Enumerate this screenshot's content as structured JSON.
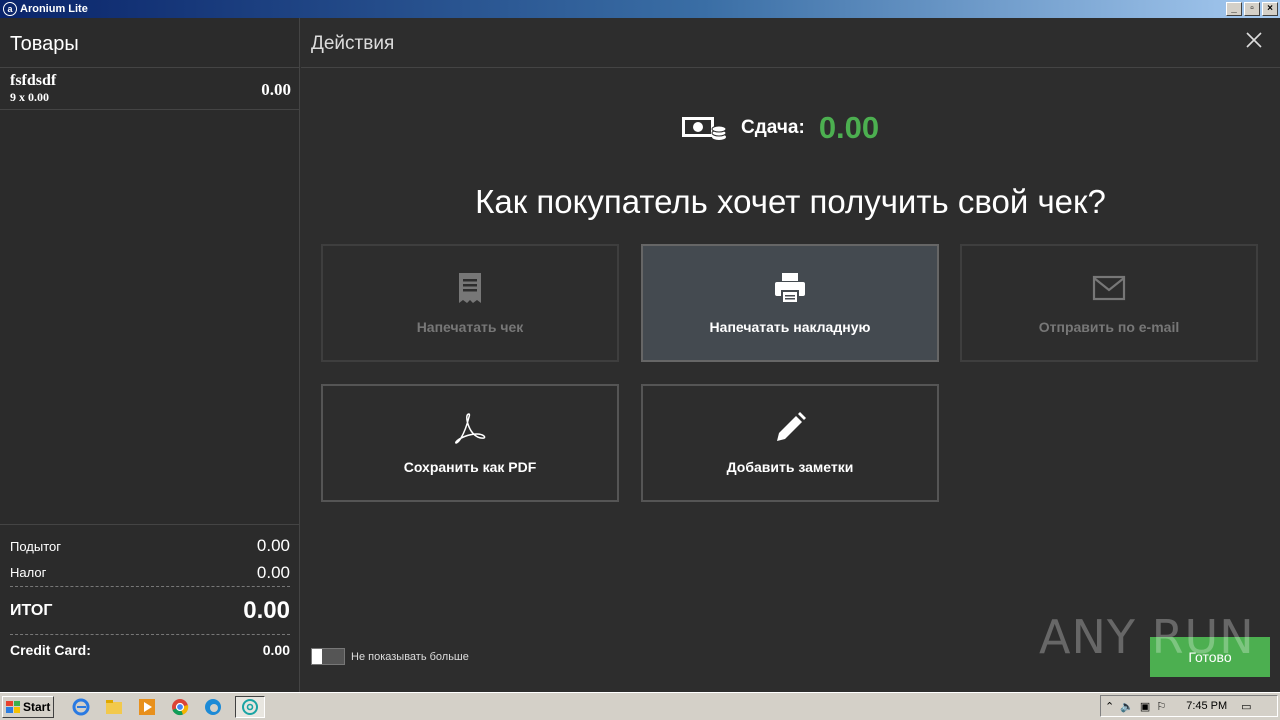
{
  "window": {
    "title": "Aronium Lite",
    "app_icon": "a"
  },
  "left": {
    "header": "Товары",
    "items": [
      {
        "name": "fsfdsdf",
        "qty": "9 x 0.00",
        "price": "0.00"
      }
    ],
    "totals": {
      "subtotal_label": "Подытог",
      "subtotal": "0.00",
      "tax_label": "Налог",
      "tax": "0.00",
      "total_label": "ИТОГ",
      "total": "0.00",
      "payment_label": "Credit Card:",
      "payment": "0.00"
    }
  },
  "right": {
    "header": "Действия",
    "change_label": "Сдача:",
    "change_value": "0.00",
    "question": "Как покупатель хочет получить свой чек?",
    "tiles": [
      {
        "label": "Напечатать чек",
        "icon": "receipt-icon",
        "state": "disabled"
      },
      {
        "label": "Напечатать накладную",
        "icon": "printer-icon",
        "state": "active"
      },
      {
        "label": "Отправить по e-mail",
        "icon": "envelope-icon",
        "state": "disabled"
      },
      {
        "label": "Сохранить как PDF",
        "icon": "pdf-icon",
        "state": "normal"
      },
      {
        "label": "Добавить заметки",
        "icon": "pencil-icon",
        "state": "normal"
      }
    ],
    "dont_show_label": "Не показывать больше",
    "done_label": "Готово",
    "watermark": "ANY RUN"
  },
  "taskbar": {
    "start_label": "Start",
    "time": "7:45 PM"
  },
  "colors": {
    "accent_green": "#4caf50",
    "background": "#2d2d2d"
  }
}
